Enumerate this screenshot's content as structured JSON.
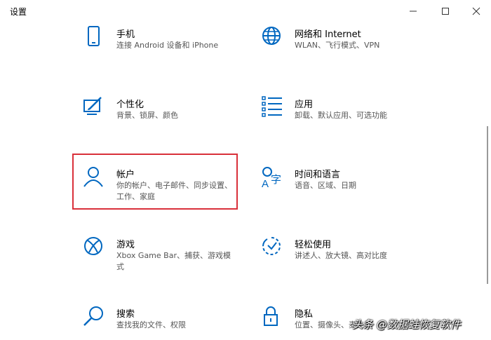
{
  "window": {
    "title": "设置"
  },
  "tiles": [
    {
      "name": "手机",
      "desc": "连接 Android 设备和 iPhone"
    },
    {
      "name": "网络和 Internet",
      "desc": "WLAN、飞行模式、VPN"
    },
    {
      "name": "个性化",
      "desc": "背景、锁屏、颜色"
    },
    {
      "name": "应用",
      "desc": "卸载、默认应用、可选功能"
    },
    {
      "name": "帐户",
      "desc": "你的帐户、电子邮件、同步设置、工作、家庭"
    },
    {
      "name": "时间和语言",
      "desc": "语音、区域、日期"
    },
    {
      "name": "游戏",
      "desc": "Xbox Game Bar、捕获、游戏模式"
    },
    {
      "name": "轻松使用",
      "desc": "讲述人、放大镜、高对比度"
    },
    {
      "name": "搜索",
      "desc": "查找我的文件、权限"
    },
    {
      "name": "隐私",
      "desc": "位置、摄像头、麦克风"
    }
  ],
  "watermark": "头条 @数据蛙恢复软件",
  "colors": {
    "accent": "#0067c0",
    "highlight": "#d9303a"
  }
}
